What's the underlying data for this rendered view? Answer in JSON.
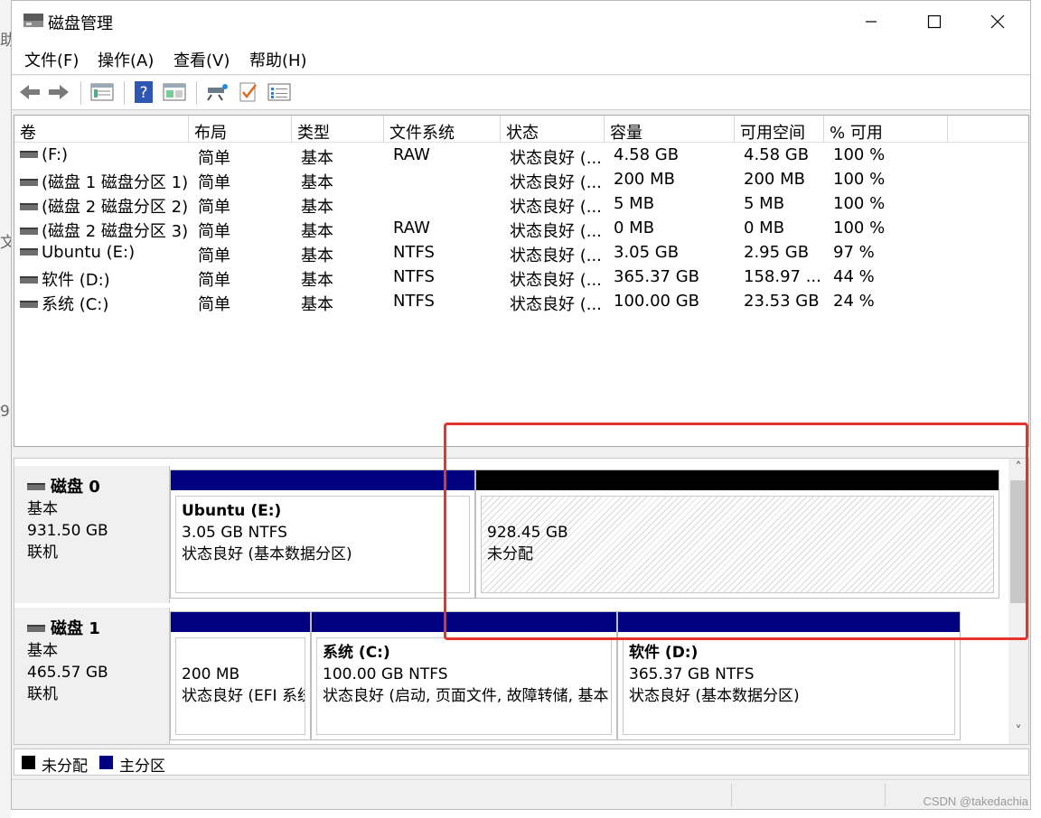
{
  "window": {
    "title": "磁盘管理",
    "controls": {
      "minimize": "—",
      "maximize": "☐",
      "close": "✕"
    }
  },
  "menu": [
    "文件(F)",
    "操作(A)",
    "查看(V)",
    "帮助(H)"
  ],
  "toolbar": [
    "back-icon",
    "forward-icon",
    "disk-list-icon",
    "help-icon",
    "properties-icon",
    "connect-icon",
    "check-icon",
    "settings-icon"
  ],
  "volumes": {
    "columns": [
      "卷",
      "布局",
      "类型",
      "文件系统",
      "状态",
      "容量",
      "可用空间",
      "% 可用"
    ],
    "rows": [
      {
        "name": "(F:)",
        "layout": "简单",
        "type": "基本",
        "fs": "RAW",
        "status": "状态良好 (...",
        "capacity": "4.58 GB",
        "free": "4.58 GB",
        "pct": "100 %"
      },
      {
        "name": "(磁盘 1 磁盘分区 1)",
        "layout": "简单",
        "type": "基本",
        "fs": "",
        "status": "状态良好 (...",
        "capacity": "200 MB",
        "free": "200 MB",
        "pct": "100 %"
      },
      {
        "name": "(磁盘 2 磁盘分区 2)",
        "layout": "简单",
        "type": "基本",
        "fs": "",
        "status": "状态良好 (...",
        "capacity": "5 MB",
        "free": "5 MB",
        "pct": "100 %"
      },
      {
        "name": "(磁盘 2 磁盘分区 3)",
        "layout": "简单",
        "type": "基本",
        "fs": "RAW",
        "status": "状态良好 (...",
        "capacity": "0 MB",
        "free": "0 MB",
        "pct": "100 %"
      },
      {
        "name": "Ubuntu (E:)",
        "layout": "简单",
        "type": "基本",
        "fs": "NTFS",
        "status": "状态良好 (...",
        "capacity": "3.05 GB",
        "free": "2.95 GB",
        "pct": "97 %"
      },
      {
        "name": "软件 (D:)",
        "layout": "简单",
        "type": "基本",
        "fs": "NTFS",
        "status": "状态良好 (...",
        "capacity": "365.37 GB",
        "free": "158.97 ...",
        "pct": "44 %"
      },
      {
        "name": "系统 (C:)",
        "layout": "简单",
        "type": "基本",
        "fs": "NTFS",
        "status": "状态良好 (...",
        "capacity": "100.00 GB",
        "free": "23.53 GB",
        "pct": "24 %"
      }
    ]
  },
  "disks": [
    {
      "name": "磁盘 0",
      "type": "基本",
      "size": "931.50 GB",
      "state": "联机",
      "partitions": [
        {
          "name": "Ubuntu  (E:)",
          "size": "3.05 GB NTFS",
          "status": "状态良好 (基本数据分区)",
          "color": "#000080"
        },
        {
          "name": "",
          "size": "928.45 GB",
          "status": "未分配",
          "color": "#000000"
        }
      ]
    },
    {
      "name": "磁盘 1",
      "type": "基本",
      "size": "465.57 GB",
      "state": "联机",
      "partitions": [
        {
          "name": "",
          "size": "200 MB",
          "status": "状态良好 (EFI 系统",
          "color": "#000080"
        },
        {
          "name": "系统  (C:)",
          "size": "100.00 GB NTFS",
          "status": "状态良好 (启动, 页面文件, 故障转储, 基本",
          "color": "#000080"
        },
        {
          "name": "软件  (D:)",
          "size": "365.37 GB NTFS",
          "status": "状态良好 (基本数据分区)",
          "color": "#000080"
        }
      ]
    }
  ],
  "legend": [
    {
      "label": "未分配",
      "color": "#000000"
    },
    {
      "label": "主分区",
      "color": "#000080"
    }
  ],
  "scroll": {
    "up": "˄",
    "down": "˅"
  },
  "watermark": "CSDN @takedachia",
  "highlight_color": "#e5342a"
}
